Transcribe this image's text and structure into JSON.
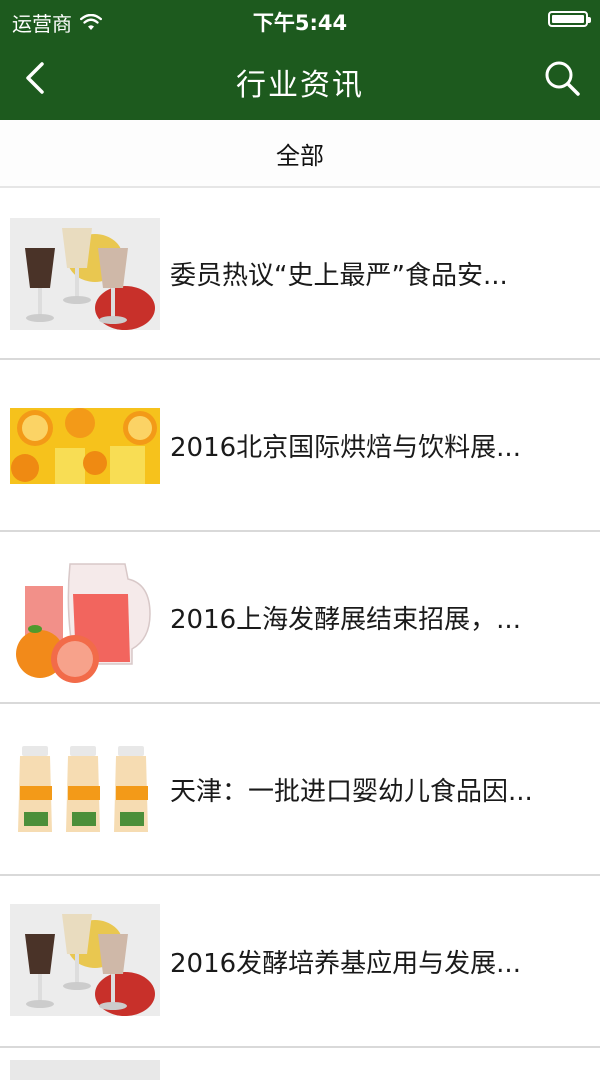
{
  "status_bar": {
    "carrier": "运营商",
    "time": "下午5:44",
    "wifi_icon": "wifi-icon",
    "battery_icon": "battery-icon"
  },
  "nav": {
    "title": "行业资讯",
    "back_icon": "chevron-left-icon",
    "search_icon": "search-icon"
  },
  "filter": {
    "label": "全部"
  },
  "articles": [
    {
      "title": "委员热议“史上最严”食品安...",
      "image": "milkshake-glasses-fruit"
    },
    {
      "title": "2016北京国际烘焙与饮料展...",
      "image": "orange-juice-splash"
    },
    {
      "title": "2016上海发酵展结束招展，...",
      "image": "grapefruit-juice-pitcher"
    },
    {
      "title": "天津：一批进口婴幼儿食品因...",
      "image": "yogurt-drink-bottles"
    },
    {
      "title": "2016发酵培养基应用与发展...",
      "image": "milkshake-glasses-fruit"
    }
  ],
  "colors": {
    "header_bg": "#1d5a1e",
    "header_text": "#ffffff",
    "divider": "#d9d9d9"
  }
}
